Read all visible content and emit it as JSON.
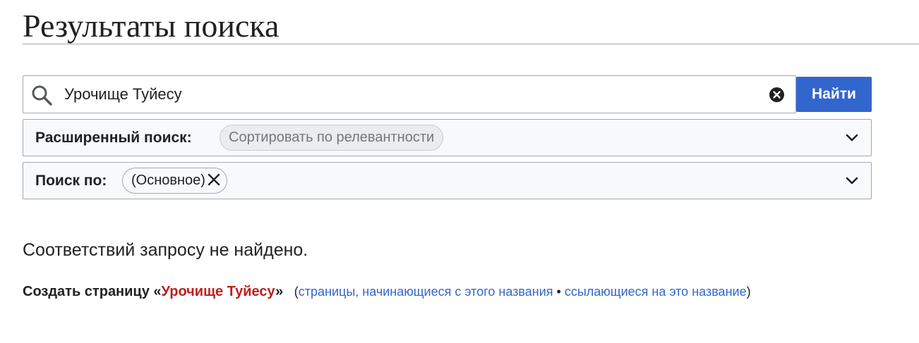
{
  "page": {
    "title": "Результаты поиска"
  },
  "search": {
    "query": "Урочище Туйесу",
    "button_label": "Найти",
    "icon": "search-icon",
    "clear_icon": "clear-icon"
  },
  "advanced": {
    "label": "Расширенный поиск:",
    "sort_chip": "Сортировать по релевантности",
    "expand_icon": "chevron-down-icon"
  },
  "namespace": {
    "label": "Поиск по:",
    "chip": "(Основное)",
    "remove_icon": "close-icon",
    "expand_icon": "chevron-down-icon"
  },
  "results": {
    "no_results_text": "Соответствий запросу не найдено.",
    "create_prefix": "Создать страницу «",
    "create_title": "Урочище Туйесу",
    "create_suffix": "»",
    "paren_open": "(",
    "prefix_link": "страницы, начинающиеся с этого названия",
    "separator": " • ",
    "links_here": "ссылающиеся на это название",
    "paren_close": ")"
  },
  "colors": {
    "accent": "#3366cc",
    "redlink": "#bf1e1e",
    "border": "#a2a9b1",
    "panel_bg": "#f8f9fa",
    "text": "#202122"
  }
}
